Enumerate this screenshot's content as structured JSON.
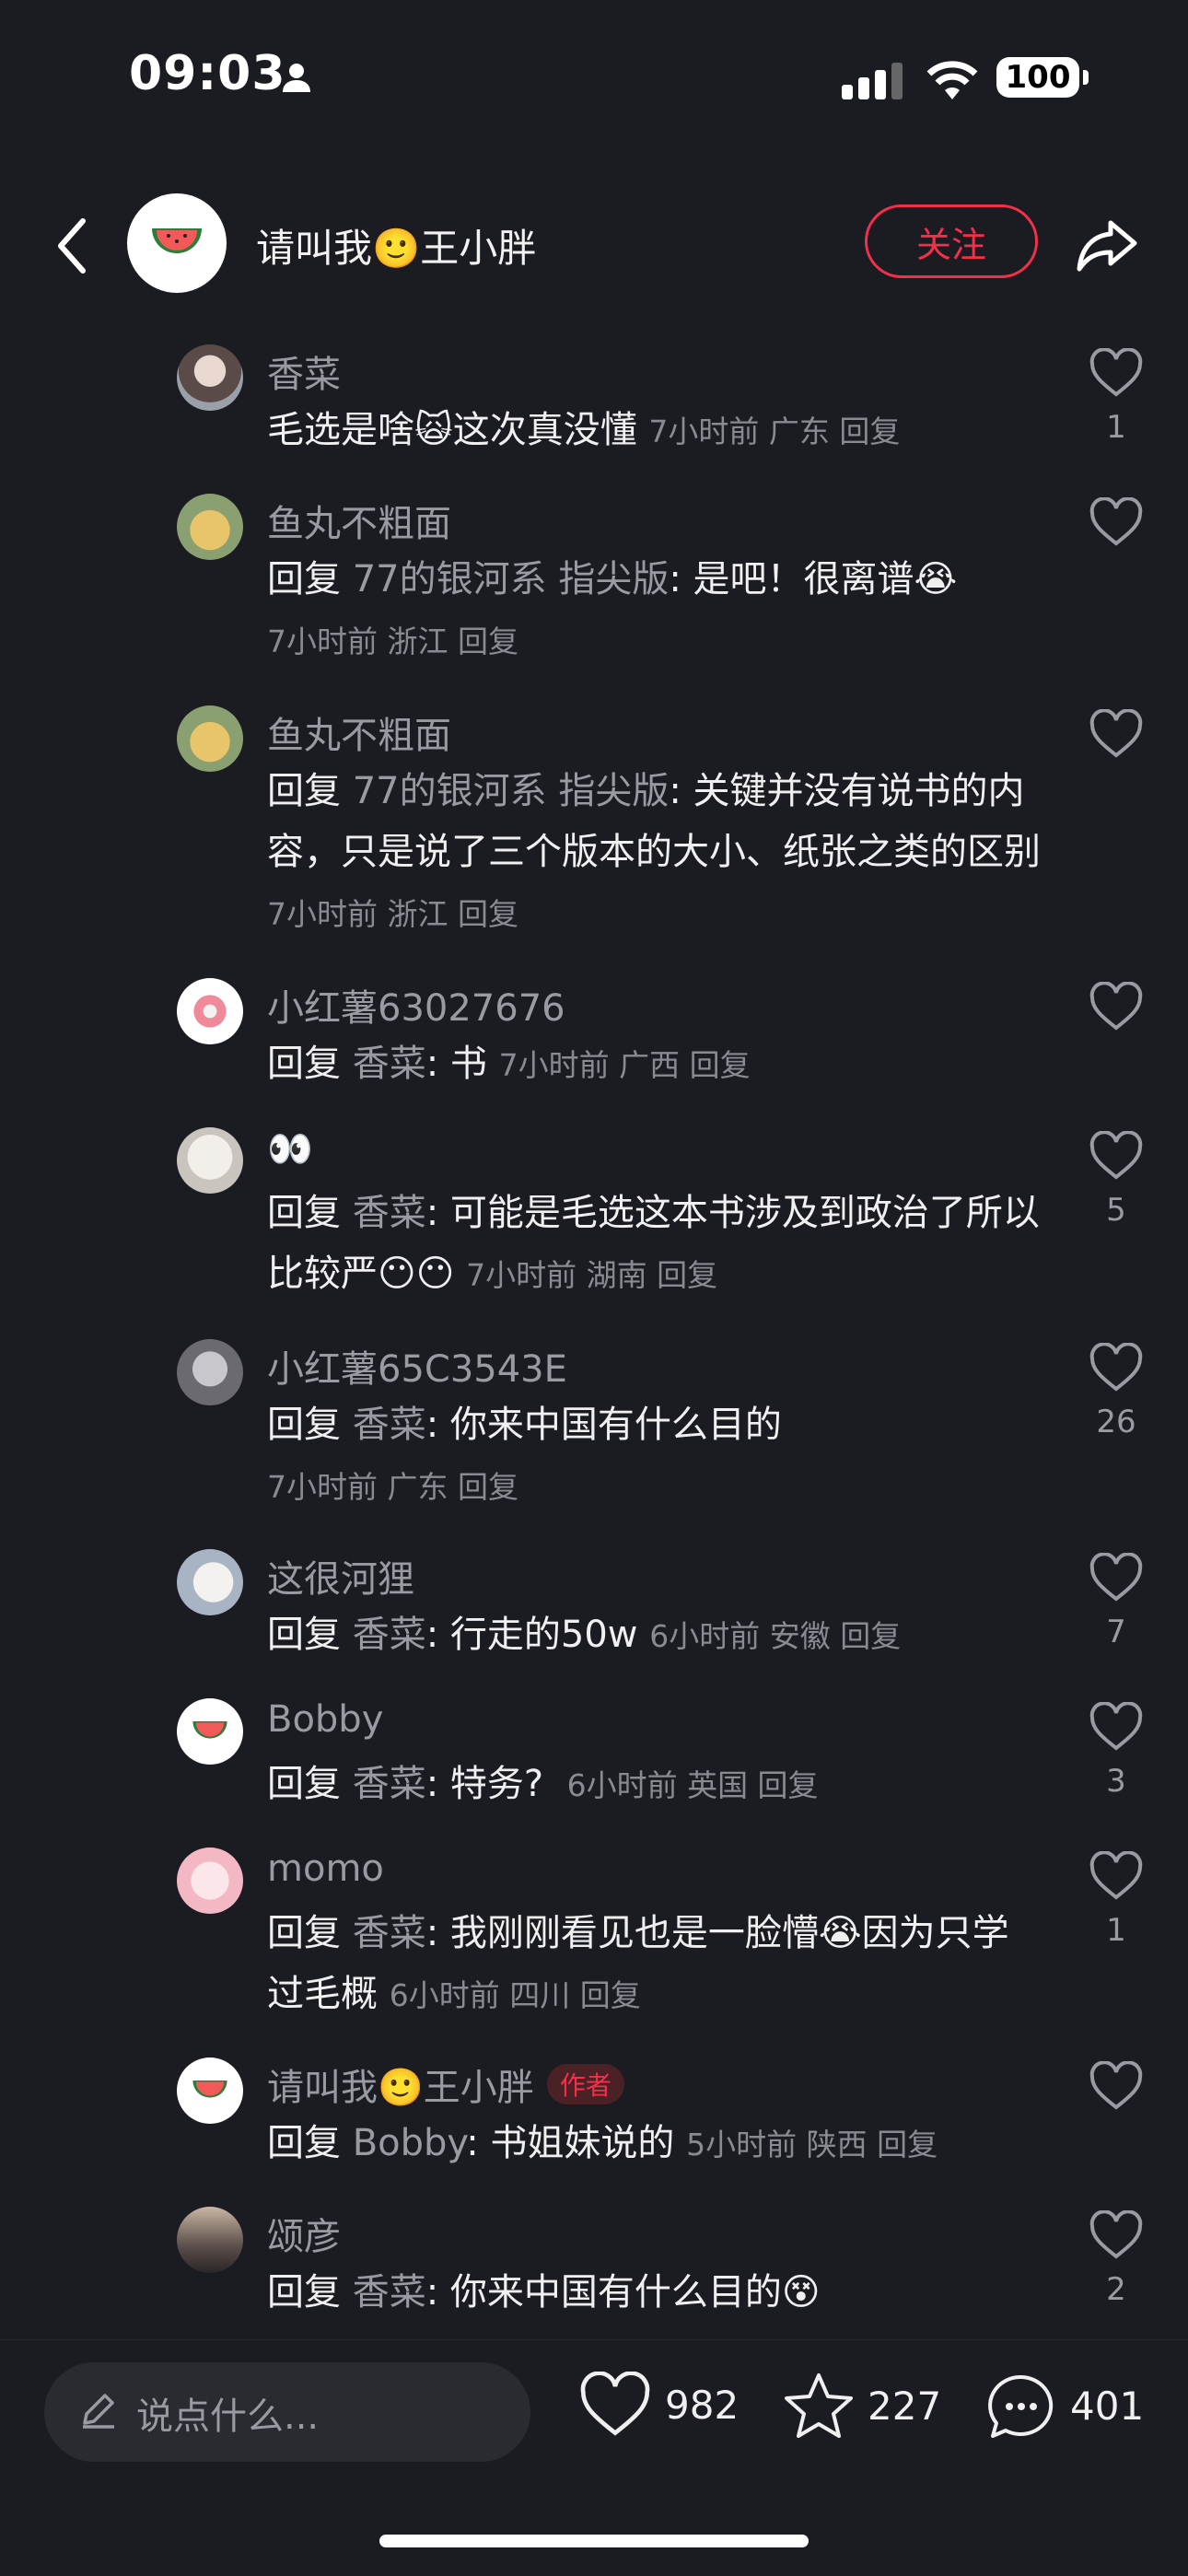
{
  "status": {
    "time": "09:03",
    "battery": "100"
  },
  "header": {
    "title": "请叫我🙂王小胖",
    "follow": "关注"
  },
  "comments": [
    {
      "name": "香菜",
      "pre": "",
      "to": "",
      "text": "毛选是啥🙀这次真没懂",
      "meta": "7小时前 广东 回复",
      "likes": "1"
    },
    {
      "name": "鱼丸不粗面",
      "pre": "回复 ",
      "to": "77的银河系 指尖版",
      "text": ": 是吧！很离谱😭",
      "meta": "7小时前 浙江 回复",
      "likes": ""
    },
    {
      "name": "鱼丸不粗面",
      "pre": "回复 ",
      "to": "77的银河系 指尖版",
      "text": ": 关键并没有说书的内容，只是说了三个版本的大小、纸张之类的区别",
      "meta": "7小时前 浙江 回复",
      "likes": ""
    },
    {
      "name": "小红薯63027676",
      "pre": "回复 ",
      "to": "香菜",
      "text": ": 书",
      "meta": "7小时前 广西 回复",
      "likes": ""
    },
    {
      "name": "👀",
      "pre": "回复 ",
      "to": "香菜",
      "text": ": 可能是毛选这本书涉及到政治了所以比较严😶😶",
      "meta": "7小时前 湖南 回复",
      "likes": "5"
    },
    {
      "name": "小红薯65C3543E",
      "pre": "回复 ",
      "to": "香菜",
      "text": ": 你来中国有什么目的",
      "meta": "7小时前 广东 回复",
      "likes": "26"
    },
    {
      "name": "这很河狸",
      "pre": "回复 ",
      "to": "香菜",
      "text": ": 行走的50w",
      "meta": "6小时前 安徽 回复",
      "likes": "7"
    },
    {
      "name": "Bobby",
      "pre": "回复 ",
      "to": "香菜",
      "text": ": 特务?",
      "meta": "6小时前 英国 回复",
      "likes": "3"
    },
    {
      "name": "momo",
      "pre": "回复 ",
      "to": "香菜",
      "text": ": 我刚刚看见也是一脸懵😭因为只学过毛概",
      "meta": "6小时前 四川 回复",
      "likes": "1"
    },
    {
      "name": "请叫我🙂王小胖",
      "badge": "作者",
      "pre": "回复 ",
      "to": "Bobby",
      "text": ": 书姐妹说的",
      "meta": "5小时前 陕西 回复",
      "likes": ""
    },
    {
      "name": "颂彦",
      "pre": "回复 ",
      "to": "香菜",
      "text": ": 你来中国有什么目的😵",
      "meta": "",
      "likes": "2"
    }
  ],
  "bottom": {
    "placeholder": "说点什么...",
    "likes": "982",
    "stars": "227",
    "comments": "401"
  },
  "colors": {
    "accent": "#f2304a",
    "background": "#1b1b22"
  }
}
